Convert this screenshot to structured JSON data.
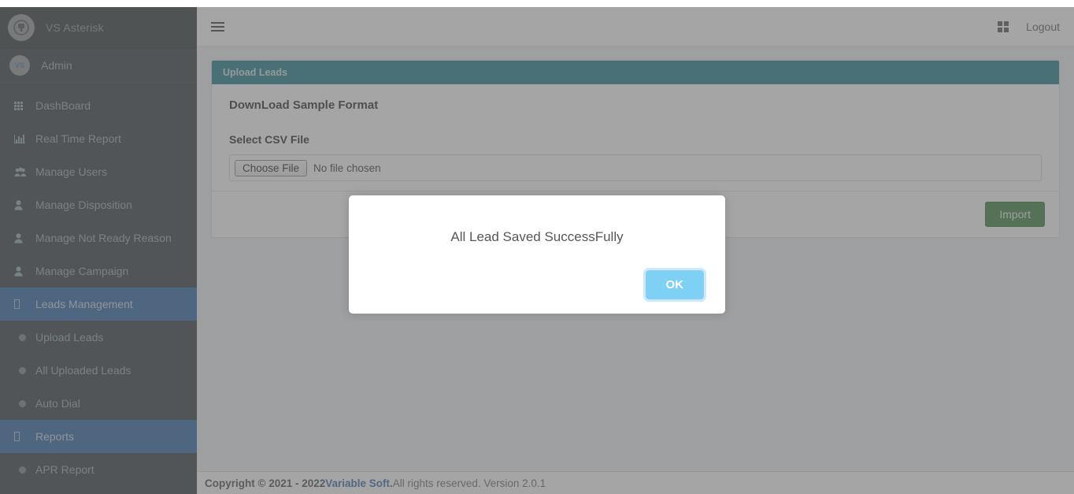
{
  "brand": {
    "title": "VS Asterisk",
    "logo_icon": "asterisk-logo-icon"
  },
  "user": {
    "name": "Admin",
    "avatar_text": "VS"
  },
  "sidebar": {
    "items": [
      {
        "label": "DashBoard",
        "icon": "grid-icon",
        "type": "top",
        "active": false
      },
      {
        "label": "Real Time Report",
        "icon": "bar-chart-icon",
        "type": "top",
        "active": false
      },
      {
        "label": "Manage Users",
        "icon": "users-icon",
        "type": "top",
        "active": false
      },
      {
        "label": "Manage Disposition",
        "icon": "user-icon",
        "type": "top",
        "active": false
      },
      {
        "label": "Manage Not Ready Reason",
        "icon": "user-icon",
        "type": "top",
        "active": false
      },
      {
        "label": "Manage Campaign",
        "icon": "user-icon",
        "type": "top",
        "active": false
      },
      {
        "label": "Leads Management",
        "icon": "missing-glyph-icon",
        "type": "top",
        "active": true
      },
      {
        "label": "Upload Leads",
        "icon": "bullet-icon",
        "type": "sub",
        "active": false
      },
      {
        "label": "All Uploaded Leads",
        "icon": "bullet-icon",
        "type": "sub",
        "active": false
      },
      {
        "label": "Auto Dial",
        "icon": "bullet-icon",
        "type": "sub",
        "active": false
      },
      {
        "label": "Reports",
        "icon": "missing-glyph-icon",
        "type": "top",
        "active": true
      },
      {
        "label": "APR Report",
        "icon": "bullet-icon",
        "type": "sub",
        "active": false
      }
    ]
  },
  "navbar": {
    "menu_toggle_icon": "hamburger-icon",
    "apps_icon": "apps-grid-icon",
    "logout_label": "Logout"
  },
  "card": {
    "header_title": "Upload Leads",
    "download_sample_label": "DownLoad Sample Format",
    "select_file_label": "Select CSV File",
    "file_input": {
      "button_label": "Choose File",
      "value": "No file chosen"
    },
    "import_button_label": "Import"
  },
  "modal": {
    "message": "All Lead Saved SuccessFully",
    "ok_label": "OK"
  },
  "footer": {
    "copyright": "Copyright © 2021 - 2022 ",
    "company": "Variable Soft.",
    "rights": " All rights reserved. Version 2.0.1"
  },
  "colors": {
    "sidebar_bg": "#222d32",
    "active_blue": "#1e5b9e",
    "card_header_teal": "#0f7287",
    "import_green": "#2d7a33",
    "ok_blue": "#7ed0f4",
    "brand_link_blue": "#2a5a9e"
  }
}
